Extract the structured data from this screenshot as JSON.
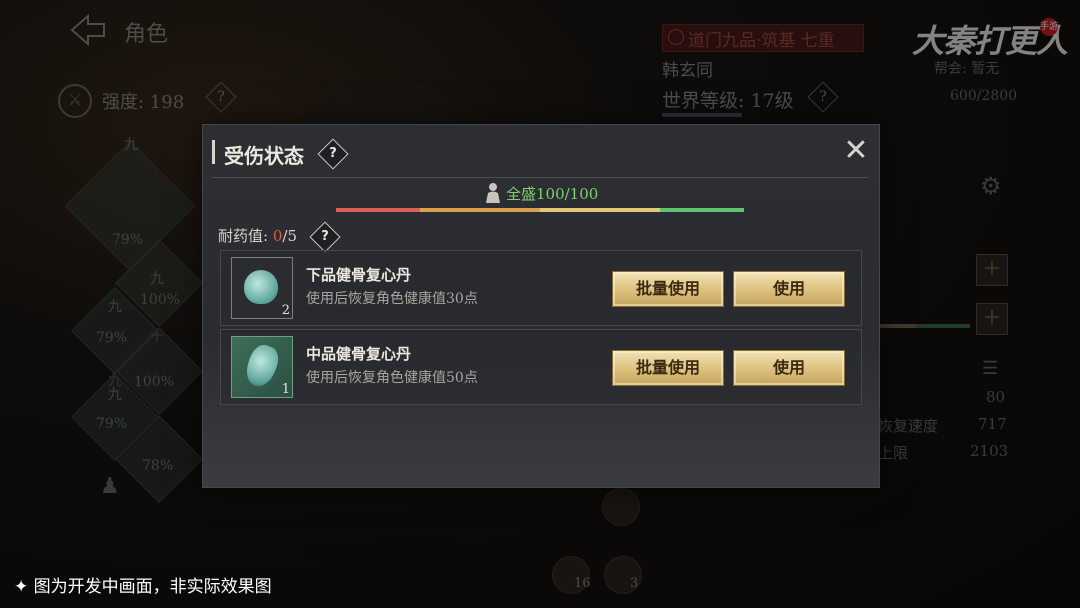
{
  "background": {
    "back_title": "角色",
    "strength_label": "强度: 198",
    "realm": "道门九品·筑基  七重",
    "character_name": "韩玄同",
    "guild": "帮会: 暂无",
    "world_level": "世界等级: 17级",
    "exp": "600/2800",
    "logo_text": "大秦打更人",
    "logo_seal": "手游",
    "equip_labels": [
      "九",
      "79%",
      "九",
      "100%",
      "九",
      "79%",
      "十",
      "九",
      "100%",
      "九",
      "79%",
      "78%"
    ],
    "stats": [
      {
        "label": "恢复速度",
        "value": "717"
      },
      {
        "label": "上限",
        "value": "2103"
      }
    ],
    "stat_80": "80",
    "bottom_counts": [
      "16",
      "3"
    ],
    "disclaimer": "✦ 图为开发中画面，非实际效果图"
  },
  "modal": {
    "title": "受伤状态",
    "help_icon": "?",
    "close_icon": "✕",
    "health_status": "全盛100/100",
    "health_fraction": 1.0,
    "tolerance_label": "耐药值:",
    "tolerance_current": "0",
    "tolerance_max": "/5",
    "items": [
      {
        "name": "下品健骨复心丹",
        "desc": "使用后恢复角色健康值30点",
        "count": "2",
        "batch_label": "批量使用",
        "use_label": "使用"
      },
      {
        "name": "中品健骨复心丹",
        "desc": "使用后恢复角色健康值50点",
        "count": "1",
        "batch_label": "批量使用",
        "use_label": "使用"
      }
    ]
  },
  "colors": {
    "health_green": "#7ed26a",
    "tolerance_red": "#e05a4a",
    "gold_button": "#dcbf7c"
  }
}
